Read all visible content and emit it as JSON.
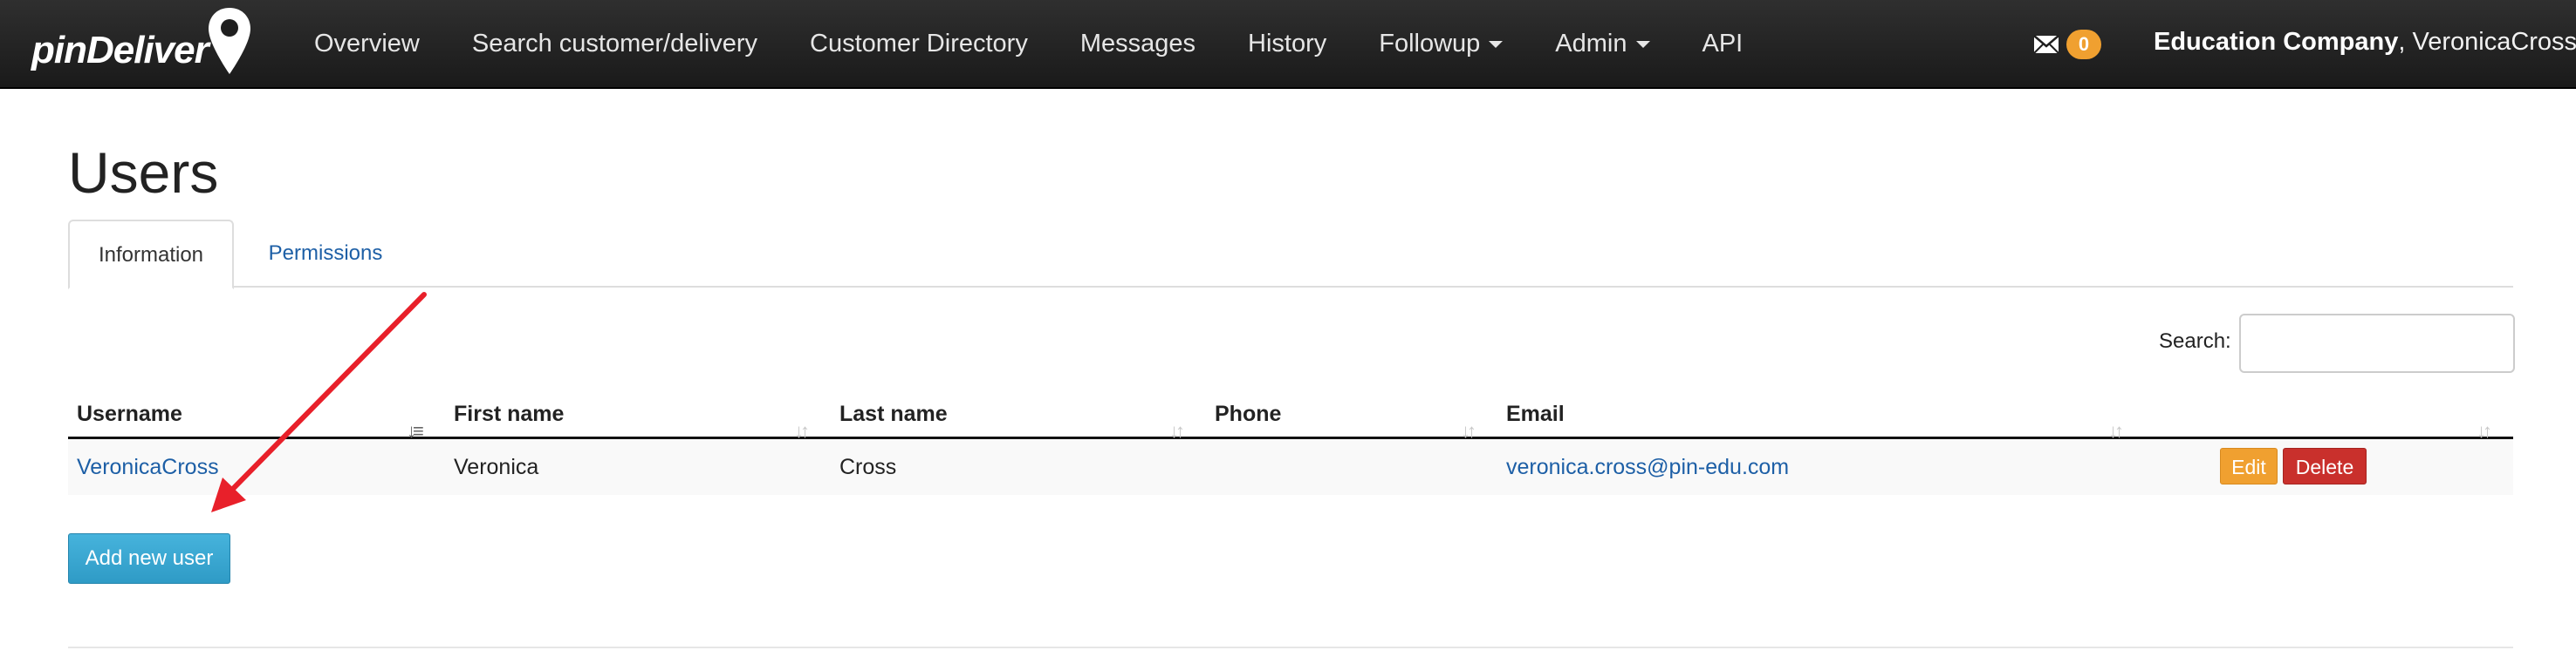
{
  "navbar": {
    "brand": "pinDeliver",
    "links": [
      {
        "label": "Overview"
      },
      {
        "label": "Search customer/delivery"
      },
      {
        "label": "Customer Directory"
      },
      {
        "label": "Messages"
      },
      {
        "label": "History"
      },
      {
        "label": "Followup",
        "dropdown": true
      },
      {
        "label": "Admin",
        "dropdown": true
      },
      {
        "label": "API"
      }
    ],
    "messages_icon": "envelope-icon",
    "messages_count": "0",
    "company": "Education Company",
    "user": ", VeronicaCross"
  },
  "page": {
    "title": "Users",
    "tabs": [
      {
        "label": "Information",
        "active": true
      },
      {
        "label": "Permissions",
        "active": false
      }
    ],
    "search_label": "Search:",
    "search_value": ""
  },
  "table": {
    "columns": [
      "Username",
      "First name",
      "Last name",
      "Phone",
      "Email",
      ""
    ],
    "rows": [
      {
        "username": "VeronicaCross",
        "first_name": "Veronica",
        "last_name": "Cross",
        "phone": "",
        "email": "veronica.cross@pin-edu.com",
        "edit_label": "Edit",
        "delete_label": "Delete"
      }
    ]
  },
  "actions": {
    "add_user_label": "Add new user"
  },
  "colors": {
    "navbar": "#1f1f1f",
    "link": "#1d5fa6",
    "badge": "#f0a030",
    "edit": "#f0a030",
    "delete": "#c9302c",
    "primary": "#39a7d2",
    "annotation_arrow": "#e8202a"
  }
}
